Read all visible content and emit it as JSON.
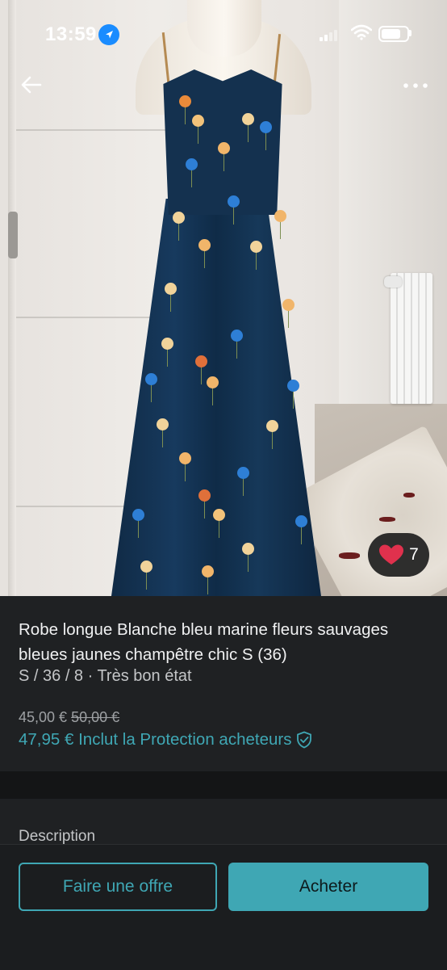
{
  "status_bar": {
    "time": "13:59",
    "location_icon": "location-arrow-icon",
    "signal_icon": "cellular-signal-icon",
    "wifi_icon": "wifi-icon",
    "battery_icon": "battery-icon",
    "battery_level": 0.75
  },
  "header": {
    "back_icon": "arrow-left-icon",
    "more_icon": "more-dots-icon"
  },
  "photo": {
    "favorite_icon": "heart-icon",
    "favorite_count": "7"
  },
  "item": {
    "title": "Robe longue Blanche bleu marine fleurs sauvages bleues jaunes champêtre chic S (36)",
    "meta": "S / 36 / 8 · Très bon état",
    "price": "45,00 €",
    "original_price": "50,00 €",
    "total_price_label": "47,95 € Inclut la Protection acheteurs",
    "protection_icon": "shield-check-icon"
  },
  "description": {
    "label": "Description"
  },
  "actions": {
    "offer_label": "Faire une offre",
    "buy_label": "Acheter"
  },
  "colors": {
    "accent": "#3fa7b4",
    "background": "#1b1d1f",
    "heart": "#e0314d"
  }
}
